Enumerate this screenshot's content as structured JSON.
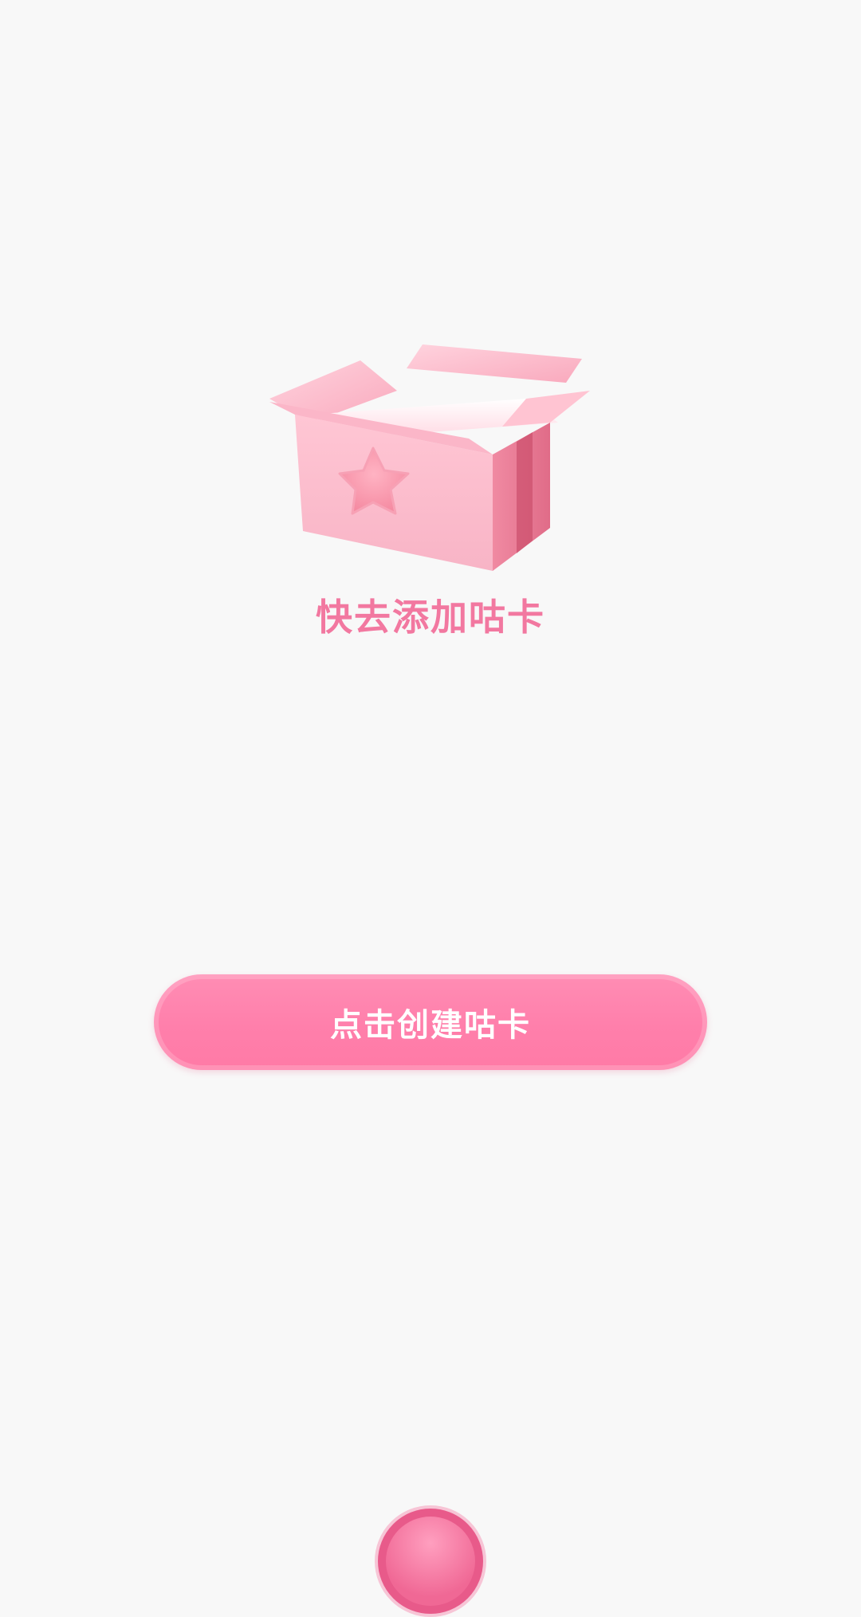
{
  "empty_state": {
    "illustration_icon": "open-gift-box-star-icon",
    "title": "快去添加咕卡"
  },
  "actions": {
    "create_label": "点击创建咕卡"
  },
  "bottom_nav": {
    "center_button_icon": "pink-circle-fab-icon"
  },
  "colors": {
    "background": "#f8f8f8",
    "accent_pink": "#ff7fab",
    "title_pink": "#f278a0"
  }
}
